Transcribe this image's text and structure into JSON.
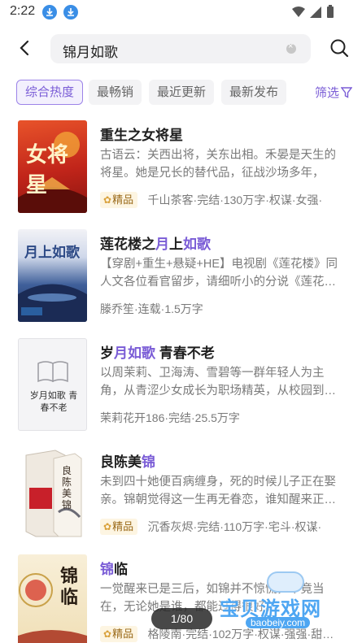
{
  "status": {
    "time": "2:22"
  },
  "search": {
    "query": "锦月如歌"
  },
  "filters": {
    "chips": [
      "综合热度",
      "最畅销",
      "最近更新",
      "最新发布"
    ],
    "filter_label": "筛选"
  },
  "books": [
    {
      "title_parts": [
        "重生之女将星",
        "",
        "",
        ""
      ],
      "desc": "古语云：关西出将，关东出相。禾晏是天生的将星。她是兄长的替代品，征战沙场多年，",
      "badge": "精品",
      "meta": "千山茶客·完结·130万字·权谋·女强·",
      "cover_text": "女将星"
    },
    {
      "title_parts": [
        "莲花楼之",
        "月",
        "上",
        "如歌"
      ],
      "desc": "【穿剧+重生+悬疑+HE】电视剧《莲花楼》同人文各位看官留步，请细听小的分说《莲花…",
      "badge": "",
      "meta": "滕乔笙·连载·1.5万字",
      "cover_text": "月上如歌"
    },
    {
      "title_parts": [
        "岁",
        "月如歌",
        " 青春不老",
        ""
      ],
      "desc": "以周茉莉、卫海涛、雪碧等一群年轻人为主角，从青涩少女成长为职场精英，从校园到…",
      "badge": "",
      "meta": "茉莉花开186·完结·25.5万字",
      "cover_text": "岁月如歌 青春不老"
    },
    {
      "title_parts": [
        "良陈美",
        "锦",
        "",
        ""
      ],
      "desc": "未到四十她便百病缠身，死的时候儿子正在娶亲。锦朝觉得这一生再无眷恋，谁知醒来正…",
      "badge": "精品",
      "meta": "沉香灰烬·完结·110万字·宅斗·权谋·",
      "cover_text": "良陈美锦"
    },
    {
      "title_parts": [
        "锦",
        "临",
        "",
        ""
      ],
      "desc": "一觉醒来已是三后，如锦并不惊慌，毕竟当在，无论她是谁，都能过得很好。",
      "badge": "精品",
      "meta": "格陵南·完结·102万字·权谋·强强·甜…",
      "cover_text": "锦临"
    }
  ],
  "pager": {
    "label": "1/80"
  },
  "watermark": {
    "main": "宝贝游戏网",
    "sub": "baobeiy.com"
  },
  "colors": {
    "accent": "#7a5cd6",
    "badge_text": "#9a6a1a",
    "badge_bg": "#fdf5e2"
  }
}
